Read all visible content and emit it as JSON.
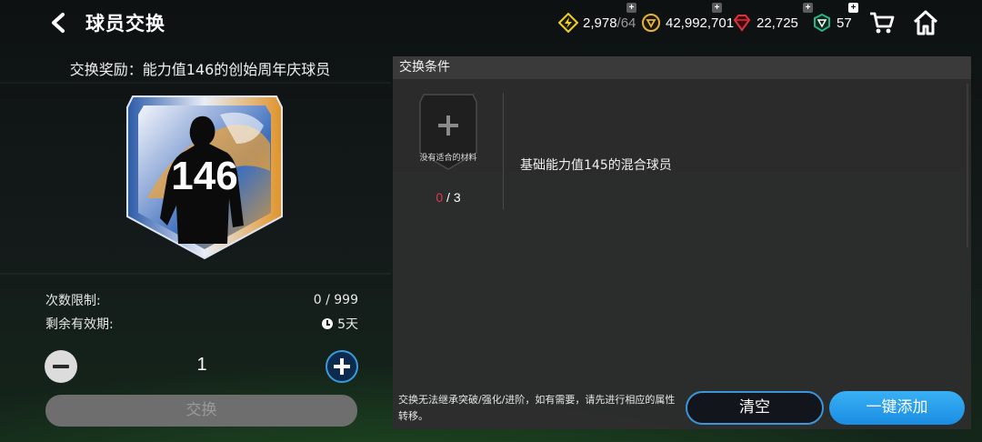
{
  "header": {
    "title": "球员交换"
  },
  "resources": {
    "energy_current": "2,978",
    "energy_max": "/64",
    "coins": "42,992,701",
    "gems": "22,725",
    "tickets": "57"
  },
  "left": {
    "reward_title": "交换奖励：能力值146的创始周年庆球员",
    "card_rating": "146",
    "limit_label": "次数限制:",
    "limit_value": "0 / 999",
    "validity_label": "剩余有效期:",
    "validity_value": "5天",
    "quantity": "1",
    "exchange_button": "交换"
  },
  "panel": {
    "title": "交换条件",
    "slot_text": "没有适合的材料",
    "slot_count_current": "0",
    "slot_count_total": " / 3",
    "requirement": "基础能力值145的混合球员",
    "note": "交换无法继承突破/强化/进阶，如有需要，请先进行相应的属性转移。",
    "clear_button": "清空",
    "add_button": "一键添加"
  },
  "colors": {
    "accent_blue": "#2a9be8",
    "count_red": "#e2364c",
    "energy_yellow": "#f3d21e",
    "gem_red": "#e0303c",
    "ticket_green": "#2fb380"
  },
  "icons": [
    "back-arrow-icon",
    "energy-icon",
    "coin-icon",
    "gem-icon",
    "ticket-icon",
    "cart-icon",
    "home-icon",
    "clock-icon",
    "minus-icon",
    "plus-icon"
  ]
}
